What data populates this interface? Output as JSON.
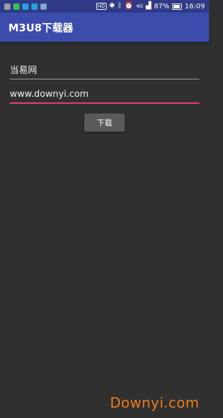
{
  "status_bar": {
    "hd": "HD",
    "network": "4G",
    "battery": "87%",
    "battery_level": 0.87,
    "time": "16:09",
    "notification_icons": [
      {
        "name": "screen-icon",
        "color": "#9e9e9e"
      },
      {
        "name": "wechat-icon",
        "color": "#35c05a"
      },
      {
        "name": "message-icon",
        "color": "#29a3e0"
      },
      {
        "name": "chat-icon",
        "color": "#29a3e0"
      },
      {
        "name": "bell-icon",
        "color": "#7fa7c7"
      }
    ]
  },
  "app_bar": {
    "title": "M3U8下载器"
  },
  "form": {
    "name_value": "当易网",
    "url_value": "www.downyi.com",
    "download_label": "下载"
  },
  "watermark": "Downyi.com",
  "colors": {
    "status_bar": "#2f3b86",
    "app_bar": "#3b4cad",
    "background": "#303030",
    "accent_underline": "#e5406a",
    "button": "#5a5a5a",
    "watermark": "#f07b1a"
  }
}
